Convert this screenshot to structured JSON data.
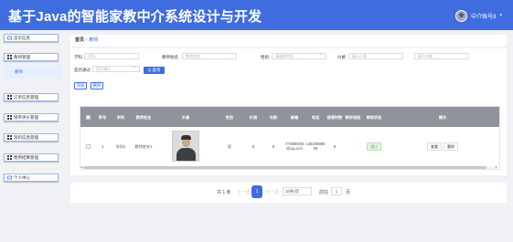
{
  "header": {
    "title": "基于Java的智能家教中介系统设计与开发",
    "user_name": "中介账号8",
    "caret": "▾"
  },
  "sidebar": {
    "items": [
      {
        "label": "首页信息",
        "icon": "home-icon"
      },
      {
        "label": "教师管理",
        "icon": "grid-icon"
      },
      {
        "label": "订单信息管理",
        "icon": "grid-icon"
      },
      {
        "label": "接单评价管理",
        "icon": "grid-icon"
      },
      {
        "label": "资料信息管理",
        "icon": "grid-icon"
      },
      {
        "label": "费用结算管理",
        "icon": "grid-icon"
      },
      {
        "label": "个人中心",
        "icon": "user-icon"
      }
    ],
    "sub_active": "教师"
  },
  "breadcrumb": {
    "home": "首页",
    "sep": "/",
    "current": "教师"
  },
  "search": {
    "subject_label": "学科",
    "subject_placeholder": "学科",
    "teacher_name_label": "教师姓名",
    "teacher_name_placeholder": "教师姓名",
    "gender_label": "性别",
    "gender_placeholder": "请选择性别",
    "price_label": "价格",
    "price_placeholder": "最小价格",
    "price_max_placeholder": "最大价格",
    "audit_label": "是否通过",
    "audit_placeholder": "是否通过",
    "query_button": "Q 查询"
  },
  "actions": {
    "add": "添加",
    "delete": "删除"
  },
  "table": {
    "headers": [
      "序号",
      "学科",
      "教师姓名",
      "头像",
      "性别",
      "价格",
      "年龄",
      "邮箱",
      "电话",
      "授课时数",
      "教学经验",
      "审核状态",
      "操作"
    ],
    "rows": [
      {
        "index": "1",
        "subject": "学科1",
        "teacher_name": "教师姓名1",
        "gender": "男",
        "price": "8",
        "age": "8",
        "email": "773890006@qq.com",
        "phone": "13823888888",
        "hours": "8",
        "experience": "",
        "status": "通过",
        "op_view": "查看",
        "op_delete": "删除"
      }
    ],
    "scroll_left": "◂",
    "scroll_right": "▸"
  },
  "pagination": {
    "total": "共 1 条",
    "prev": "上一页",
    "current_page": "1",
    "next": "下一页",
    "page_size": "10条/页",
    "goto_label": "前往",
    "goto_value": "1",
    "page_suffix": "页"
  },
  "colors": {
    "accent": "#3f6de0",
    "header_bg": "#909399",
    "status_green": "#5cb85c"
  }
}
